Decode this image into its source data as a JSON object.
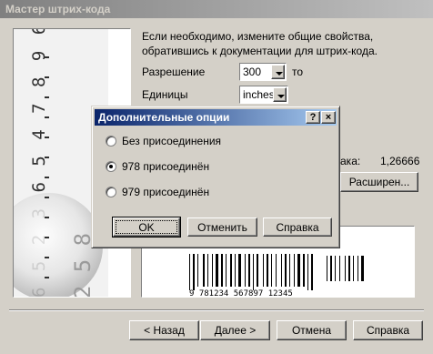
{
  "window": {
    "title": "Мастер штрих-кода"
  },
  "image_panel": {
    "digits": "6 5 2 3 6 5 4 7 8 9 6 9 0"
  },
  "description": "Если необходимо, измените общие свойства, обратившись к документации для штрих-кода.",
  "resolution": {
    "label": "Разрешение",
    "value": "300",
    "unit": "то"
  },
  "units": {
    "label": "Единицы",
    "value": "inches"
  },
  "width_readout": {
    "label": "ака:",
    "value": "1,26666"
  },
  "advanced_button": "Расширен...",
  "barcode": {
    "text": "9 781234 567897     12345"
  },
  "footer": {
    "back": "< Назад",
    "next": "Далее >",
    "cancel": "Отмена",
    "help": "Справка"
  },
  "dialog": {
    "title": "Дополнительные опции",
    "help_btn": "?",
    "close_btn": "×",
    "options": [
      {
        "label": "Без присоединения",
        "checked": false
      },
      {
        "label": "978 присоединён",
        "checked": true
      },
      {
        "label": "979 присоединён",
        "checked": false
      }
    ],
    "ok": "OK",
    "cancel": "Отменить",
    "help": "Справка"
  }
}
